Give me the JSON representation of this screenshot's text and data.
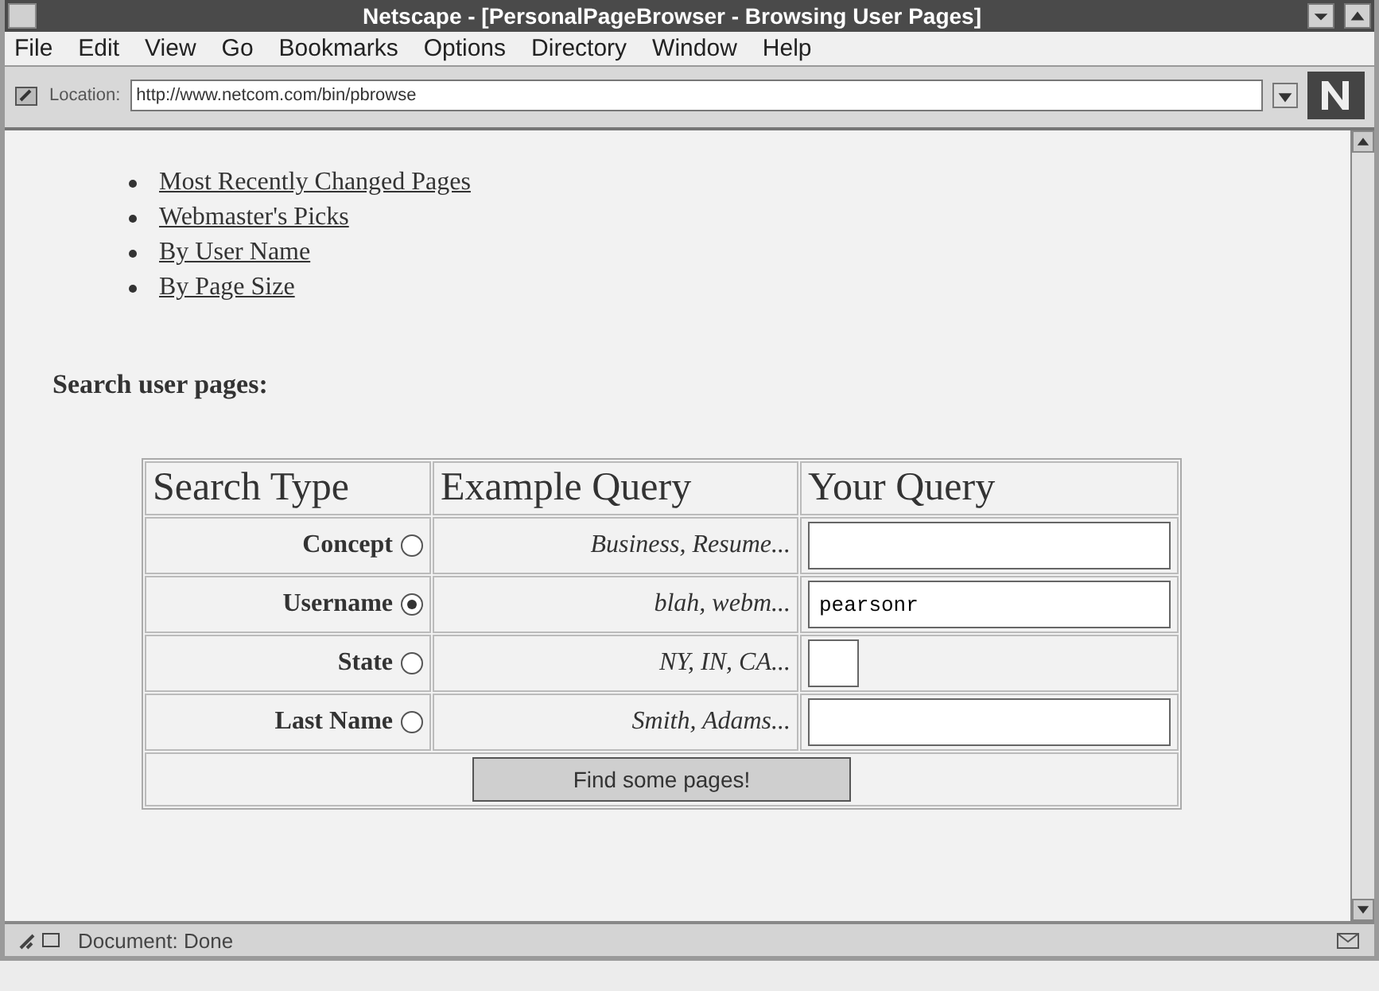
{
  "window": {
    "title": "Netscape - [PersonalPageBrowser - Browsing User Pages]"
  },
  "menu": [
    "File",
    "Edit",
    "View",
    "Go",
    "Bookmarks",
    "Options",
    "Directory",
    "Window",
    "Help"
  ],
  "location": {
    "label": "Location:",
    "value": "http://www.netcom.com/bin/pbrowse"
  },
  "links": [
    "Most Recently Changed Pages",
    "Webmaster's Picks",
    "By User Name",
    "By Page Size"
  ],
  "search_heading": "Search user pages:",
  "table": {
    "columns": [
      "Search Type",
      "Example Query",
      "Your Query"
    ],
    "rows": [
      {
        "label": "Concept",
        "selected": false,
        "example": "Business, Resume...",
        "kind": "long"
      },
      {
        "label": "Username",
        "selected": true,
        "example": "blah, webm...",
        "value": "pearsonr",
        "kind": "long"
      },
      {
        "label": "State",
        "selected": false,
        "example": "NY, IN, CA...",
        "kind": "short"
      },
      {
        "label": "Last Name",
        "selected": false,
        "example": "Smith, Adams...",
        "kind": "long"
      }
    ],
    "button": "Find some pages!"
  },
  "status_bar": {
    "text": "Document: Done"
  }
}
